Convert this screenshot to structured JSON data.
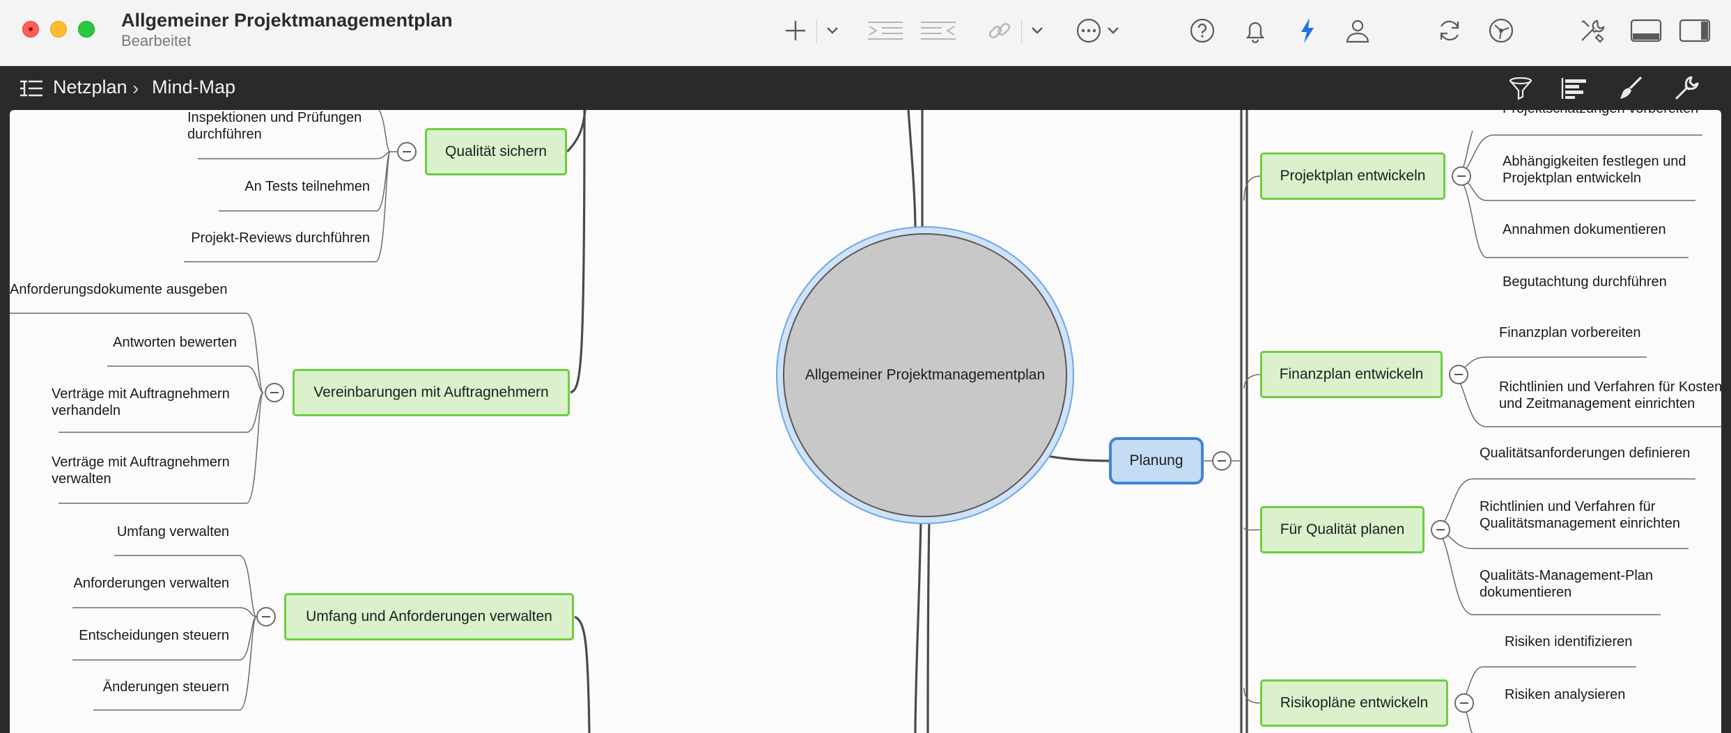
{
  "window": {
    "title": "Allgemeiner Projektmanagementplan",
    "subtitle": "Bearbeitet"
  },
  "breadcrumb": {
    "items": [
      "Netzplan",
      "Mind-Map"
    ]
  },
  "toolbar": {
    "icons": [
      "plus-icon",
      "chevron-down-icon",
      "indent-icon",
      "outdent-icon",
      "link-icon",
      "chevron-down-icon",
      "more-icon",
      "chevron-down-icon",
      "help-icon",
      "bell-icon",
      "lightning-icon",
      "user-icon",
      "sync-icon",
      "network-icon",
      "tools-icon",
      "bottom-panel-icon",
      "sidebar-icon"
    ],
    "accent_color": "#1a73e8"
  },
  "pathbar": {
    "icons": [
      "outline-icon",
      "filter-icon",
      "gantt-icon",
      "brush-icon",
      "wrench-icon"
    ]
  },
  "mindmap": {
    "root": "Allgemeiner Projektmanagementplan",
    "planung": "Planung",
    "left_nodes": {
      "qualitaet": "Qualität sichern",
      "vereinbarungen": "Vereinbarungen mit Auftragnehmern",
      "umfang": "Umfang und Anforderungen verwalten"
    },
    "left_leaves": {
      "q1": "Inspektionen und Prüfungen durchführen",
      "q2": "An Tests teilnehmen",
      "q3": "Projekt-Reviews durchführen",
      "v1": "Anforderungsdokumente ausgeben",
      "v2": "Antworten bewerten",
      "v3": "Verträge mit Auftragnehmern verhandeln",
      "v4": "Verträge mit Auftragnehmern verwalten",
      "u1": "Umfang verwalten",
      "u2": "Anforderungen verwalten",
      "u3": "Entscheidungen steuern",
      "u4": "Änderungen steuern"
    },
    "right_nodes": {
      "projektplan": "Projektplan entwickeln",
      "finanzplan": "Finanzplan entwickeln",
      "qualitaet_planen": "Für Qualität planen",
      "risiko": "Risikopläne entwickeln"
    },
    "right_leaves": {
      "p0": "Projektschätzungen vorbereiten",
      "p1": "Abhängigkeiten festlegen und Projektplan entwickeln",
      "p2": "Annahmen dokumentieren",
      "p3": "Begutachtung durchführen",
      "f1": "Finanzplan vorbereiten",
      "f2": "Richtlinien und Verfahren für Kosten- und Zeitmanagement einrichten",
      "ql1": "Qualitätsanforderungen definieren",
      "ql2": "Richtlinien und Verfahren für Qualitätsmanagement einrichten",
      "ql3": "Qualitäts-Management-Plan dokumentieren",
      "r1": "Risiken identifizieren",
      "r2": "Risiken analysieren"
    }
  }
}
